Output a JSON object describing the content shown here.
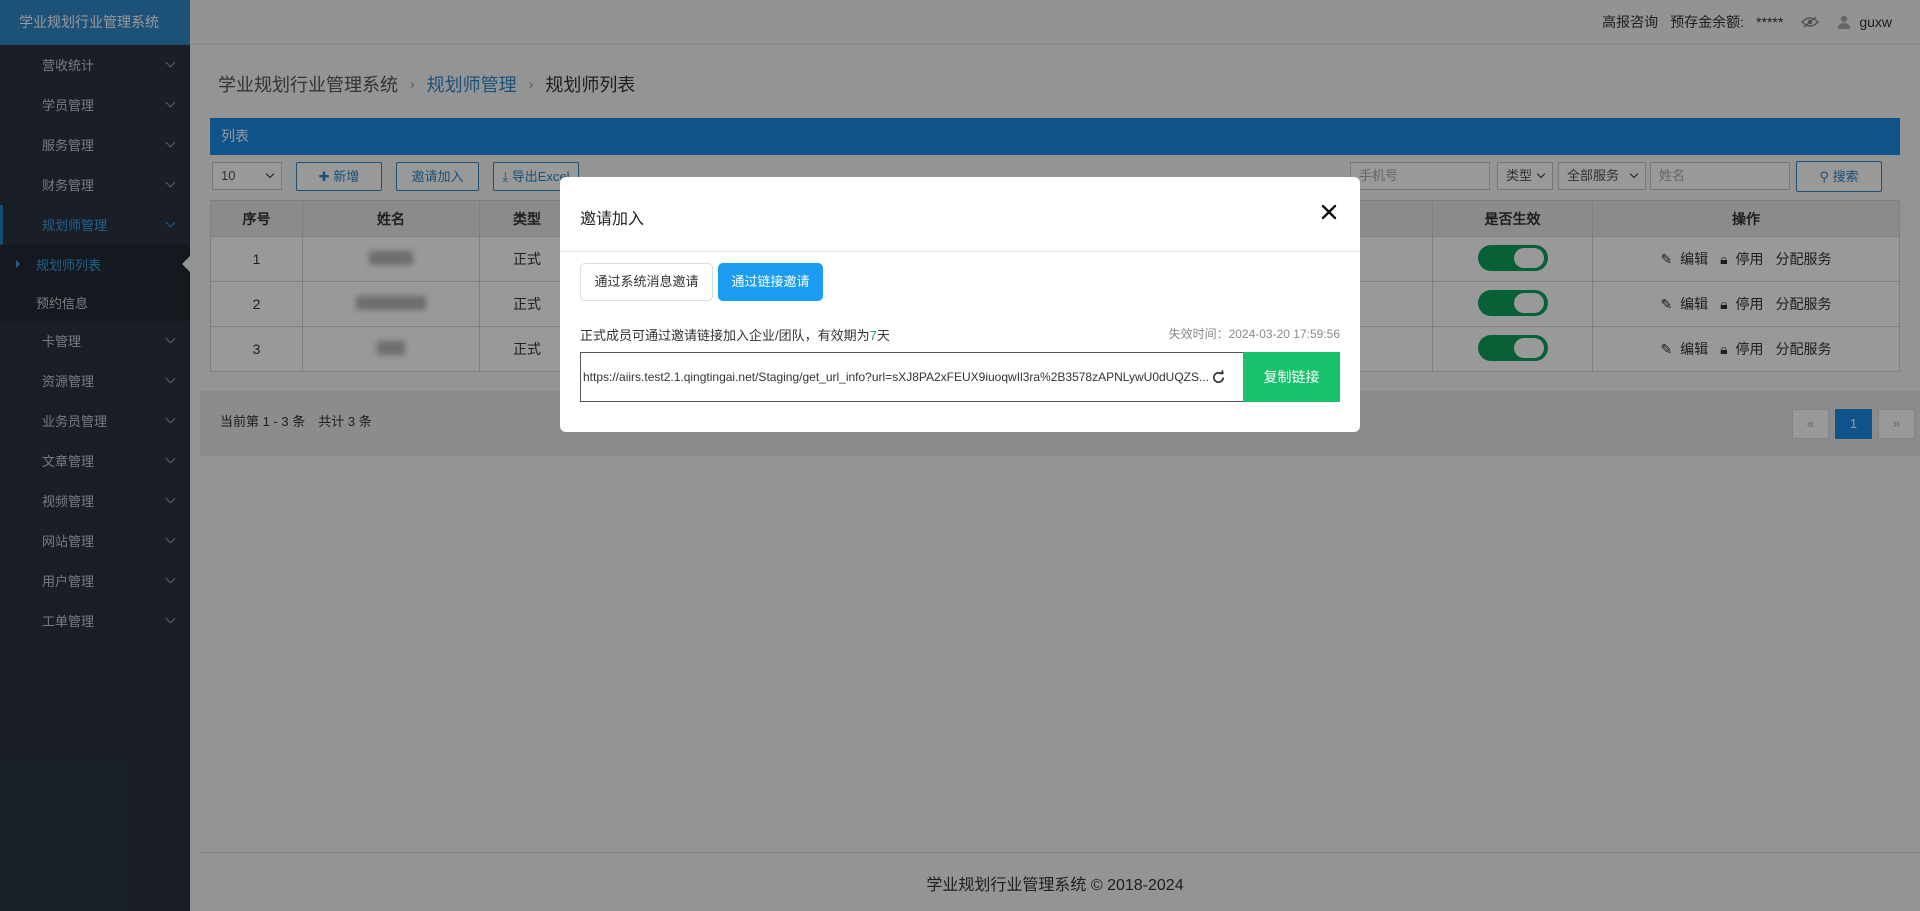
{
  "sidebar": {
    "brand": "学业规划行业管理系统",
    "items": [
      {
        "label": "营收统计"
      },
      {
        "label": "学员管理"
      },
      {
        "label": "服务管理"
      },
      {
        "label": "财务管理"
      },
      {
        "label": "规划师管理"
      },
      {
        "label": "卡管理"
      },
      {
        "label": "资源管理"
      },
      {
        "label": "业务员管理"
      },
      {
        "label": "文章管理"
      },
      {
        "label": "视频管理"
      },
      {
        "label": "网站管理"
      },
      {
        "label": "用户管理"
      },
      {
        "label": "工单管理"
      }
    ],
    "subitems": [
      {
        "label": "规划师列表"
      },
      {
        "label": "预约信息"
      }
    ]
  },
  "topbar": {
    "consult": "高报咨询",
    "balance_label": "预存金余额:",
    "balance_value": "*****",
    "username": "guxw"
  },
  "breadcrumb": {
    "root": "学业规划行业管理系统",
    "section": "规划师管理",
    "current": "规划师列表"
  },
  "panel": {
    "title": "列表"
  },
  "toolbar": {
    "page_size": "10",
    "add_label": "新增",
    "invite_label": "邀请加入",
    "export_label": "导出Excel",
    "phone_placeholder": "手机号",
    "type_select": "类型",
    "service_select": "全部服务",
    "name_placeholder": "姓名",
    "search_label": "搜索"
  },
  "table": {
    "headers": {
      "index": "序号",
      "name": "姓名",
      "type": "类型",
      "active": "是否生效",
      "ops": "操作"
    },
    "rows": [
      {
        "index": "1",
        "type": "正式"
      },
      {
        "index": "2",
        "type": "正式"
      },
      {
        "index": "3",
        "type": "正式"
      }
    ],
    "ops": {
      "edit": "编辑",
      "disable": "停用",
      "assign": "分配服务"
    }
  },
  "pager": {
    "summary": "当前第 1 - 3 条　共计 3 条",
    "prev": "«",
    "page": "1",
    "next": "»"
  },
  "footer": "学业规划行业管理系统 © 2018-2024",
  "modal": {
    "title": "邀请加入",
    "tab_message": "通过系统消息邀请",
    "tab_link": "通过链接邀请",
    "desc_prefix": "正式成员可通过邀请链接加入企业/团队，有效期为",
    "desc_days": "7",
    "desc_suffix": "天",
    "expire": "失效时间：2024-03-20 17:59:56",
    "link": "https://aiirs.test2.1.qingtingai.net/Staging/get_url_info?url=sXJ8PA2xFEUX9iuoqwIl3ra%2B3578zAPNLywU0dUQZS...",
    "copy_label": "复制链接"
  },
  "colors": {
    "brand": "#2f87c8",
    "panel": "#1a8ae6",
    "toggle_on": "#0ea05a",
    "copy_button": "#16c26a",
    "tab_active": "#1a9cf0"
  }
}
